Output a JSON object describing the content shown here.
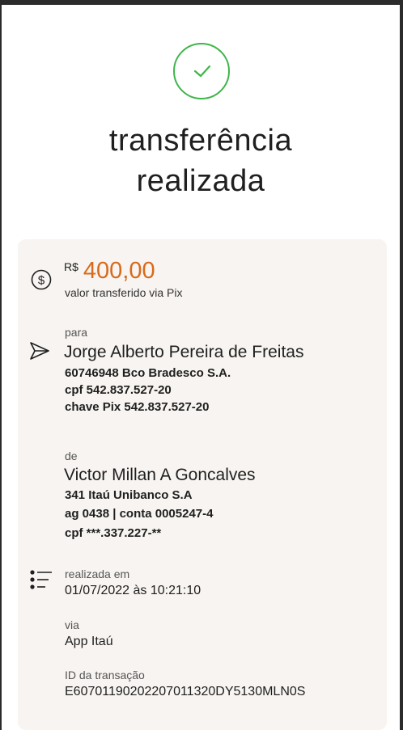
{
  "header": {
    "title_line1": "transferência",
    "title_line2": "realizada"
  },
  "amount": {
    "currency": "R$",
    "value": "400,00",
    "caption": "valor transferido via Pix"
  },
  "recipient": {
    "label": "para",
    "name": "Jorge Alberto Pereira de Freitas",
    "bank": "60746948 Bco Bradesco S.A.",
    "cpf": "cpf 542.837.527-20",
    "pix_key": "chave Pix 542.837.527-20"
  },
  "sender": {
    "label": "de",
    "name": "Victor Millan A Goncalves",
    "bank": "341 Itaú Unibanco S.A",
    "account": "ag 0438 | conta 0005247-4",
    "cpf": "cpf ***.337.227-**"
  },
  "details": {
    "date_label": "realizada em",
    "date_value": "01/07/2022 às 10:21:10",
    "via_label": "via",
    "via_value": "App Itaú",
    "id_label": "ID da transação",
    "id_value": "E60701190202207011320DY5130MLN0S"
  },
  "icons": {
    "success": "check-circle-icon",
    "money": "dollar-circle-icon",
    "send": "paper-plane-icon",
    "details": "list-icon"
  },
  "colors": {
    "accent_orange": "#d86a1a",
    "success_green": "#3fb54a",
    "card_bg": "#f7f4f1"
  }
}
